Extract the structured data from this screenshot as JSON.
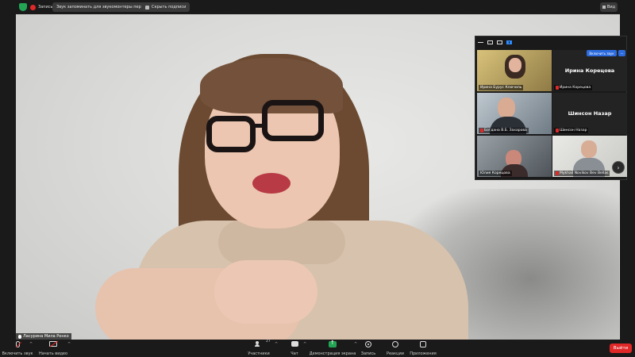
{
  "topbar": {
    "recording_label": "Запись",
    "audio_pill": "Звук запоминать для звукомонтеры персиса",
    "subtitle_pill": "Скрыть подписи",
    "view_label": "Вид"
  },
  "main": {
    "speaker_name": "Ласурина Мила Ренко"
  },
  "gallery": {
    "join_button": "Включить звук",
    "more_button": "···",
    "tiles": [
      {
        "label": "Ирина Бурус Ключиль",
        "center": ""
      },
      {
        "label": "Ирина Корецова",
        "center": "Ирина Корецова"
      },
      {
        "label": "Богдана В.Б. Захарова",
        "center": ""
      },
      {
        "label": "Шинсон Назар",
        "center": "Шинсон Назар"
      },
      {
        "label": "Юлия Корецова",
        "center": ""
      },
      {
        "label": "Mykhail Novikov Bev Bellas",
        "center": ""
      }
    ]
  },
  "toolbar": {
    "unmute_label": "Включить звук",
    "video_label": "Начать видео",
    "participants_label": "Участники",
    "participants_count": "27",
    "chat_label": "Чат",
    "share_label": "Демонстрация экрана",
    "record_label": "Запись",
    "reactions_label": "Реакции",
    "apps_label": "Приложения",
    "leave_label": "Выйти"
  },
  "colors": {
    "share_green": "#23a455",
    "muted_red": "#e02828",
    "accent_blue": "#2d8cff"
  }
}
